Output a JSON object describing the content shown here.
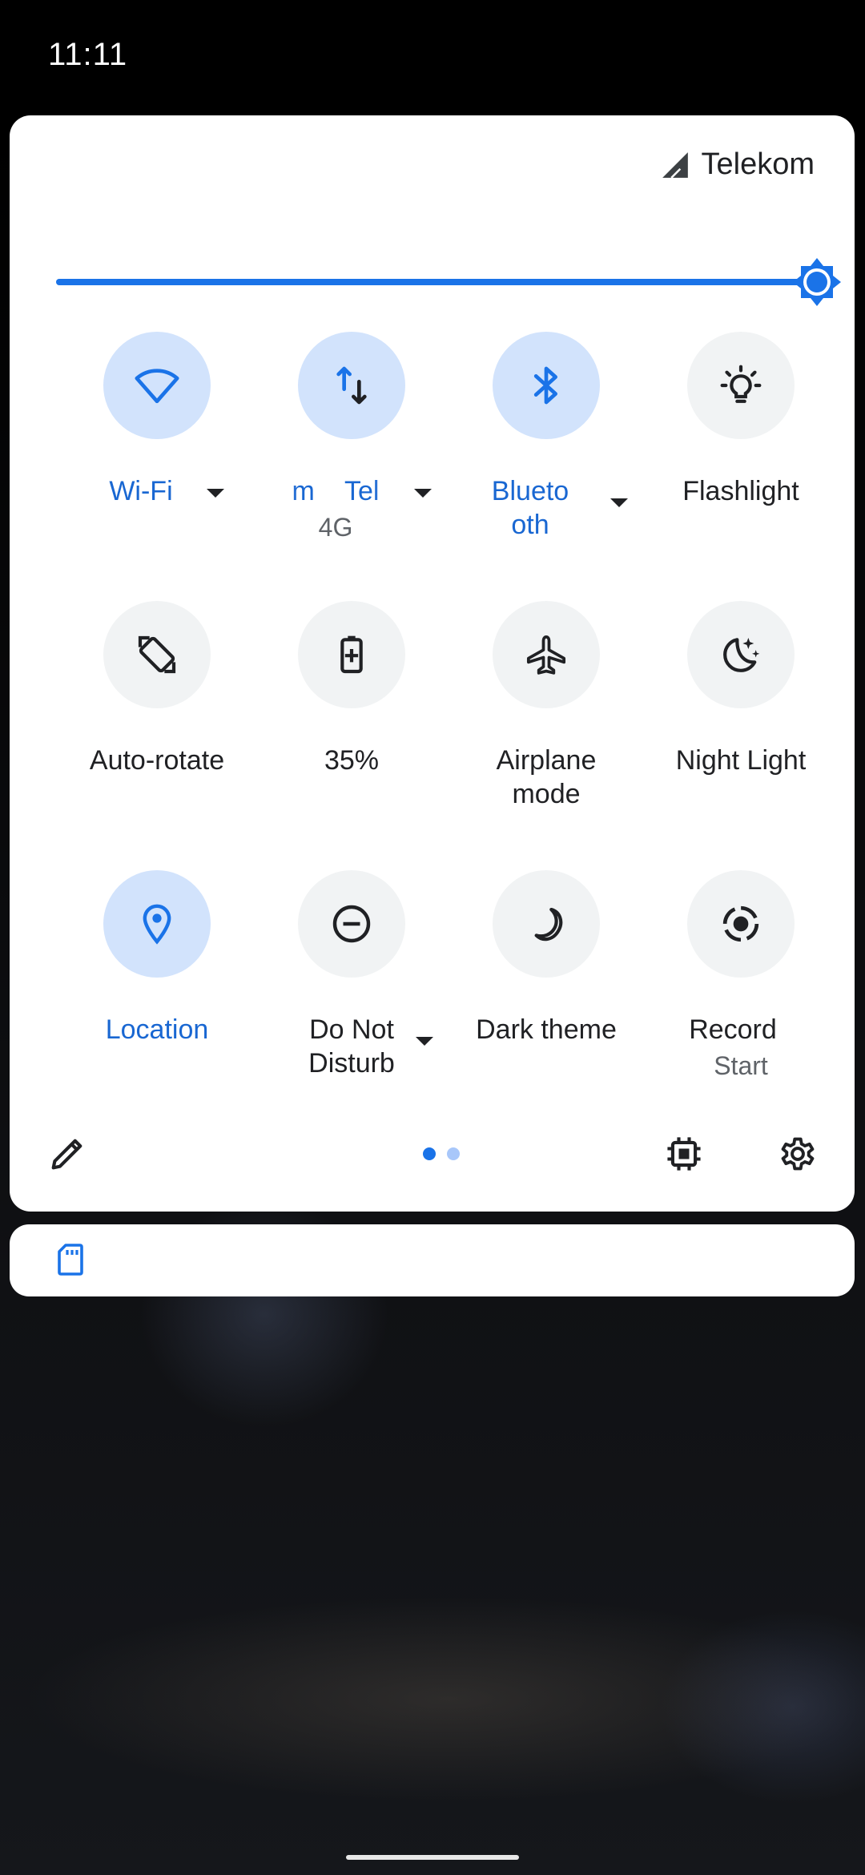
{
  "status_bar": {
    "time": "11:11"
  },
  "panel": {
    "carrier": {
      "name": "Telekom",
      "icon": "signal-icon"
    },
    "brightness": {
      "level": 1.0,
      "icon": "brightness-icon"
    },
    "tiles": [
      {
        "id": "wifi",
        "label": "Wi-Fi",
        "state": "on",
        "icon": "wifi-icon"
      },
      {
        "id": "mobile-data",
        "label": "m    Tel",
        "sublabel": "4G",
        "state": "on",
        "icon": "mobile-data-icon"
      },
      {
        "id": "bluetooth",
        "label": "Blueto",
        "label2": "oth",
        "state": "on",
        "icon": "bluetooth-icon"
      },
      {
        "id": "flashlight",
        "label": "Flashlight",
        "state": "off",
        "icon": "flashlight-icon"
      },
      {
        "id": "auto-rotate",
        "label": "Auto-rotate",
        "state": "off",
        "icon": "auto-rotate-icon"
      },
      {
        "id": "battery-saver",
        "label": "35%",
        "state": "off",
        "icon": "battery-icon"
      },
      {
        "id": "airplane",
        "label": "Airplane",
        "label2": "mode",
        "state": "off",
        "icon": "airplane-icon"
      },
      {
        "id": "night-light",
        "label": "Night Light",
        "state": "off",
        "icon": "night-light-icon"
      },
      {
        "id": "location",
        "label": "Location",
        "state": "on",
        "icon": "location-icon"
      },
      {
        "id": "dnd",
        "label": "Do Not",
        "label2": "Disturb",
        "state": "off",
        "icon": "dnd-icon"
      },
      {
        "id": "dark-theme",
        "label": "Dark theme",
        "state": "off",
        "icon": "dark-theme-icon"
      },
      {
        "id": "screen-record",
        "label": "Record",
        "sublabel": "Start",
        "state": "off",
        "icon": "screen-record-icon"
      }
    ],
    "footer": {
      "edit_icon": "edit-icon",
      "pages_total": 2,
      "page_current": 1,
      "chip_icon": "chip-icon",
      "settings_icon": "settings-icon"
    }
  },
  "notification": {
    "icon": "sd-card-icon"
  },
  "colors": {
    "accent": "#1a73e8",
    "tile_active_bg": "#d2e3fc",
    "tile_inactive_bg": "#f1f3f4",
    "label_active": "#1967d2",
    "label_inactive": "#202124"
  }
}
